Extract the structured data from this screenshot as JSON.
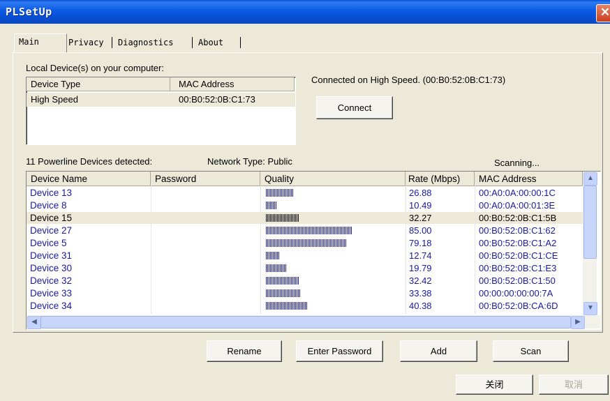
{
  "window": {
    "title": "PLSetUp",
    "close_glyph": "✕"
  },
  "tabs": [
    "Main",
    "Privacy",
    "Diagnostics",
    "About"
  ],
  "local": {
    "label": "Local Device(s) on your computer:",
    "columns": [
      "Device Type",
      "MAC Address"
    ],
    "rows": [
      {
        "type": "High Speed",
        "mac": "00:B0:52:0B:C1:73"
      }
    ]
  },
  "status": {
    "connected": "Connected on  High Speed. (00:B0:52:0B:C1:73)"
  },
  "buttons": {
    "connect": "Connect",
    "rename": "Rename",
    "enter_password": "Enter Password",
    "add": "Add",
    "scan": "Scan",
    "close": "关闭",
    "cancel": "取消"
  },
  "powerline": {
    "detected": "11 Powerline Devices detected:",
    "network_type": "Network Type: Public",
    "scanning": "Scanning...",
    "columns": [
      "Device Name",
      "Password",
      "Quality",
      "Rate (Mbps)",
      "MAC Address"
    ],
    "devices": [
      {
        "name": "Device 13",
        "password": "",
        "quality": 26.88,
        "rate": "26.88",
        "mac": "00:A0:0A:00:00:1C"
      },
      {
        "name": "Device 8",
        "password": "",
        "quality": 10.49,
        "rate": "10.49",
        "mac": "00:A0:0A:00:01:3E"
      },
      {
        "name": "Device 15",
        "password": "",
        "quality": 32.27,
        "rate": "32.27",
        "mac": "00:B0:52:0B:C1:5B",
        "selected": true
      },
      {
        "name": "Device 27",
        "password": "",
        "quality": 85.0,
        "rate": "85.00",
        "mac": "00:B0:52:0B:C1:62"
      },
      {
        "name": "Device 5",
        "password": "",
        "quality": 79.18,
        "rate": "79.18",
        "mac": "00:B0:52:0B:C1:A2"
      },
      {
        "name": "Device 31",
        "password": "",
        "quality": 12.74,
        "rate": "12.74",
        "mac": "00:B0:52:0B:C1:CE"
      },
      {
        "name": "Device 30",
        "password": "",
        "quality": 19.79,
        "rate": "19.79",
        "mac": "00:B0:52:0B:C1:E3"
      },
      {
        "name": "Device 32",
        "password": "",
        "quality": 32.42,
        "rate": "32.42",
        "mac": "00:B0:52:0B:C1:50"
      },
      {
        "name": "Device 33",
        "password": "",
        "quality": 33.38,
        "rate": "33.38",
        "mac": "00:00:00:00:00:7A"
      },
      {
        "name": "Device 34",
        "password": "",
        "quality": 40.38,
        "rate": "40.38",
        "mac": "00:B0:52:0B:CA:6D"
      }
    ]
  }
}
